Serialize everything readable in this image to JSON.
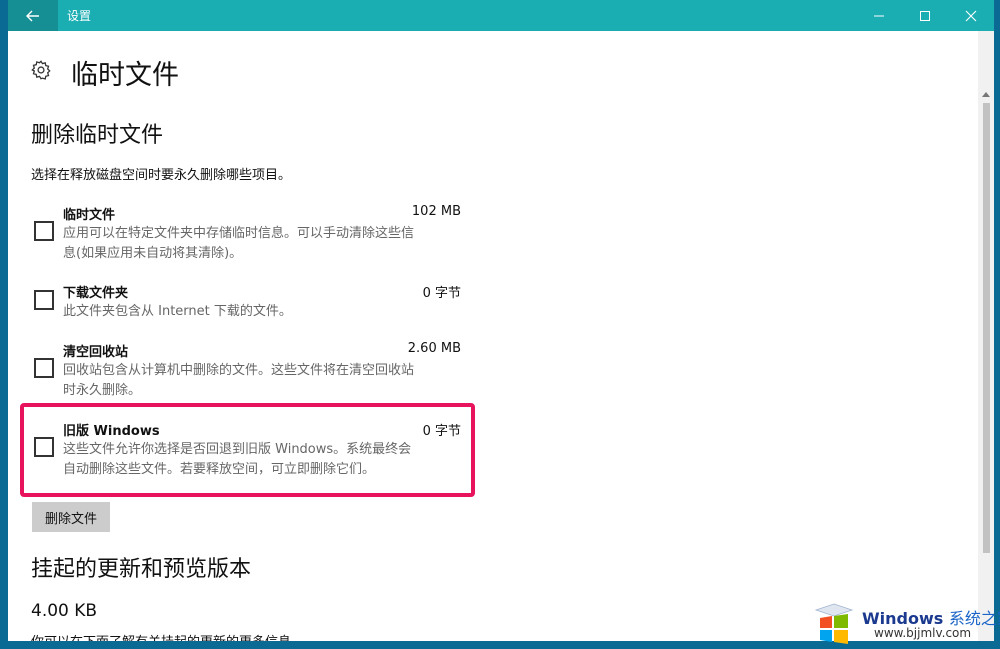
{
  "window": {
    "title": "设置"
  },
  "page": {
    "title": "临时文件"
  },
  "section1": {
    "title": "删除临时文件",
    "description": "选择在释放磁盘空间时要永久删除哪些项目。",
    "items": [
      {
        "name": "临时文件",
        "size": "102 MB",
        "desc_line1": "应用可以在特定文件夹中存储临时信息。可以手动清除这些信",
        "desc_line2": "息(如果应用未自动将其清除)。",
        "checked": false
      },
      {
        "name": "下载文件夹",
        "size": "0 字节",
        "desc_line1": "此文件夹包含从 Internet 下载的文件。",
        "desc_line2": "",
        "checked": false
      },
      {
        "name": "清空回收站",
        "size": "2.60 MB",
        "desc_line1": "回收站包含从计算机中删除的文件。这些文件将在清空回收站",
        "desc_line2": "时永久删除。",
        "checked": false
      },
      {
        "name": "旧版 Windows",
        "size": "0 字节",
        "desc_line1": "这些文件允许你选择是否回退到旧版 Windows。系统最终会",
        "desc_line2": "自动删除这些文件。若要释放空间，可立即删除它们。",
        "checked": false
      }
    ],
    "delete_button": "删除文件"
  },
  "section2": {
    "title": "挂起的更新和预览版本",
    "size": "4.00 KB",
    "partial_text": "你可以在下面了解有关挂起的更新的更多信息"
  },
  "watermark": {
    "line1_brand": "Windows",
    "line1_cn": "系统之家",
    "line2": "www.bjjmlv.com"
  },
  "colors": {
    "titlebar": "#1aaeb3",
    "highlight": "#e8135d"
  }
}
